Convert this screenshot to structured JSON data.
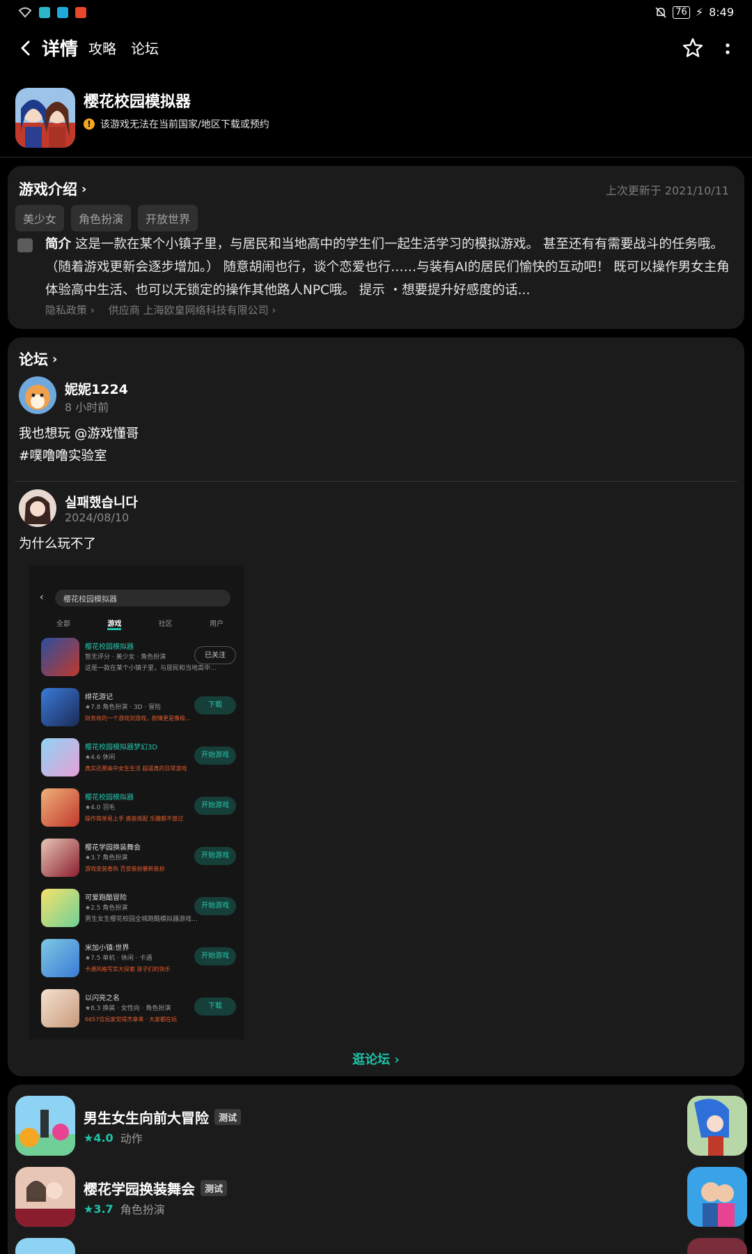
{
  "status": {
    "battery": "76",
    "time": "8:49"
  },
  "nav": {
    "tabs": [
      "详情",
      "攻略",
      "论坛"
    ]
  },
  "game": {
    "title": "樱花校园模拟器",
    "notice": "该游戏无法在当前国家/地区下载或预约"
  },
  "intro": {
    "title": "游戏介绍",
    "updated": "上次更新于 2021/10/11",
    "tags": [
      "美少女",
      "角色扮演",
      "开放世界"
    ],
    "desc_label": "简介",
    "desc": "这是一款在某个小镇子里，与居民和当地高中的学生们一起生活学习的模拟游戏。 甚至还有有需要战斗的任务哦。（随着游戏更新会逐步增加。） 随意胡闹也行，谈个恋爱也行……与装有AI的居民们愉快的互动吧！ 既可以操作男女主角体验高中生活、也可以无锁定的操作其他路人NPC哦。 提示 ・想要提升好感度的话...",
    "privacy": "隐私政策",
    "provider": "供应商 上海欧皇网络科技有限公司"
  },
  "forum": {
    "title": "论坛",
    "posts": [
      {
        "user": "妮妮1224",
        "time": "8 小时前",
        "line1": "我也想玩 @游戏懂哥",
        "line2": " #噗噜噜实验室"
      },
      {
        "user": "실패했습니다",
        "time": "2024/08/10",
        "line1": "为什么玩不了"
      }
    ],
    "visit": "逛论坛"
  },
  "screenshot": {
    "search": "樱花校园模拟器",
    "tabs": [
      "全部",
      "游戏",
      "社区",
      "用户"
    ],
    "rows": [
      {
        "name": "樱花校园模拟器",
        "sub": "暂无评分 · 美少女 · 角色扮演",
        "hot": "这是一款在某个小镇子里，与居民和当地高中…",
        "btn": "已关注"
      },
      {
        "name": "绯花游记",
        "sub": "★7.8 角色扮演 · 3D · 冒险",
        "hot": "财务收的一个游戏剑游戏，剧情更是像极…",
        "btn": "下载"
      },
      {
        "name": "樱花校园模拟器梦幻3D",
        "sub": "★4.6 休闲",
        "hot": "真实还原高中女生生活 超逼真的日常游戏",
        "btn": "开始游戏"
      },
      {
        "name": "樱花校园模拟器",
        "sub": "★4.0 羽毛",
        "hot": "操作简单易上手 换装搭配 乐趣都不放过",
        "btn": "开始游戏"
      },
      {
        "name": "樱花学园换装舞会",
        "sub": "★3.7 角色扮演",
        "hot": "游戏变装香热 百变装扮暴新装扮",
        "btn": "开始游戏"
      },
      {
        "name": "可爱跑酷冒险",
        "sub": "★2.5 角色扮演",
        "hot": "男生女生樱花校园全城跑酷模拟器游戏…",
        "btn": "开始游戏"
      },
      {
        "name": "米加小镇:世界",
        "sub": "★7.5 单机 · 休闲 · 卡通",
        "hot": "卡通风格写实大探索 孩子们的快乐",
        "btn": "开始游戏"
      },
      {
        "name": "以闪亮之名",
        "sub": "★8.3 换装 · 女性向 · 角色扮演",
        "hot": "6657位玩家觉得杰章来 · 大家都在玩",
        "btn": "下载"
      }
    ]
  },
  "recommend": [
    {
      "name": "男生女生向前大冒险",
      "badge": "测试",
      "score": "★4.0",
      "genre": "动作"
    },
    {
      "name": "樱花学园换装舞会",
      "badge": "测试",
      "score": "★3.7",
      "genre": "角色扮演"
    }
  ],
  "colors": {
    "accent": "#1fc3a8",
    "card": "#1b1b1b",
    "bg": "#000000"
  }
}
